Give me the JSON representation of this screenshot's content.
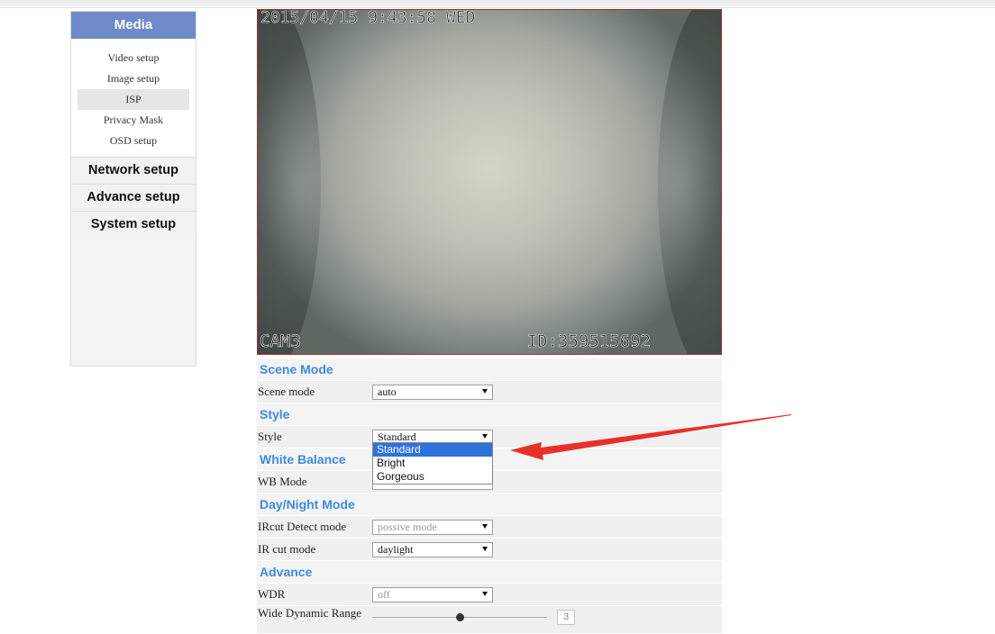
{
  "sidebar": {
    "header": "Media",
    "sub_items": [
      {
        "label": "Video setup",
        "active": false
      },
      {
        "label": "Image setup",
        "active": false
      },
      {
        "label": "ISP",
        "active": true
      },
      {
        "label": "Privacy Mask",
        "active": false
      },
      {
        "label": "OSD setup",
        "active": false
      }
    ],
    "main_items": [
      "Network setup",
      "Advance setup",
      "System setup"
    ]
  },
  "video": {
    "timestamp": "2015/04/15 9:43:58 WED",
    "camera": "CAM3",
    "device_id": "ID:359515692"
  },
  "settings": {
    "scene": {
      "section": "Scene Mode",
      "label": "Scene mode",
      "value": "auto"
    },
    "style": {
      "section": "Style",
      "label": "Style",
      "value": "Standard",
      "options": [
        "Standard",
        "Bright",
        "Gorgeous"
      ],
      "highlighted": "Standard"
    },
    "white_balance": {
      "section": "White Balance",
      "label": "WB Mode",
      "value": ""
    },
    "day_night": {
      "section": "Day/Night Mode",
      "ircut_detect_label": "IRcut Detect mode",
      "ircut_detect_value": "possive mode",
      "ir_cut_label": "IR cut mode",
      "ir_cut_value": "daylight"
    },
    "advance": {
      "section": "Advance",
      "wdr_label": "WDR",
      "wdr_value": "off",
      "wdr_range_label": "Wide Dynamic Range",
      "wdr_range_value": "3",
      "wdr_range_fraction": 0.5
    }
  },
  "colors": {
    "sidebar_header": "#6e8ac8",
    "section_title": "#3f8bd8",
    "dropdown_highlight": "#2f72dd",
    "annotation_arrow": "#e8302a"
  }
}
